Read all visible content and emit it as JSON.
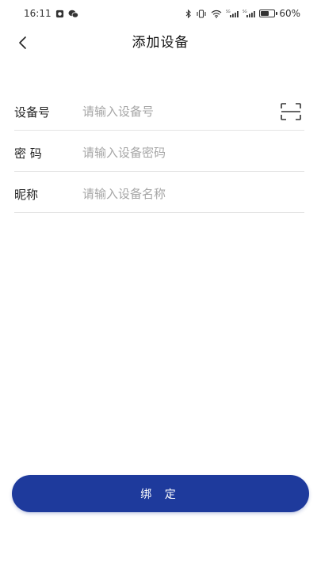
{
  "status_bar": {
    "time": "16:11",
    "battery_text": "60%",
    "battery_level": 0.6,
    "left_icons": [
      "alarm-icon",
      "wechat-icon"
    ],
    "right_icons": [
      "bluetooth-icon",
      "vibrate-icon",
      "wifi-icon",
      "signal-5g-icon",
      "signal-5g-icon",
      "battery-icon"
    ]
  },
  "header": {
    "title": "添加设备",
    "back_icon": "chevron-left-icon"
  },
  "form": {
    "device_id": {
      "label": "设备号",
      "placeholder": "请输入设备号",
      "value": "",
      "action_icon": "scan-icon"
    },
    "password": {
      "label": "密 码",
      "placeholder": "请输入设备密码",
      "value": ""
    },
    "nickname": {
      "label": "昵称",
      "placeholder": "请输入设备名称",
      "value": ""
    }
  },
  "bind_button": {
    "label": "绑 定"
  },
  "colors": {
    "primary": "#1e3a9c",
    "divider": "#e3e3e3",
    "placeholder": "#a6a6a6"
  }
}
